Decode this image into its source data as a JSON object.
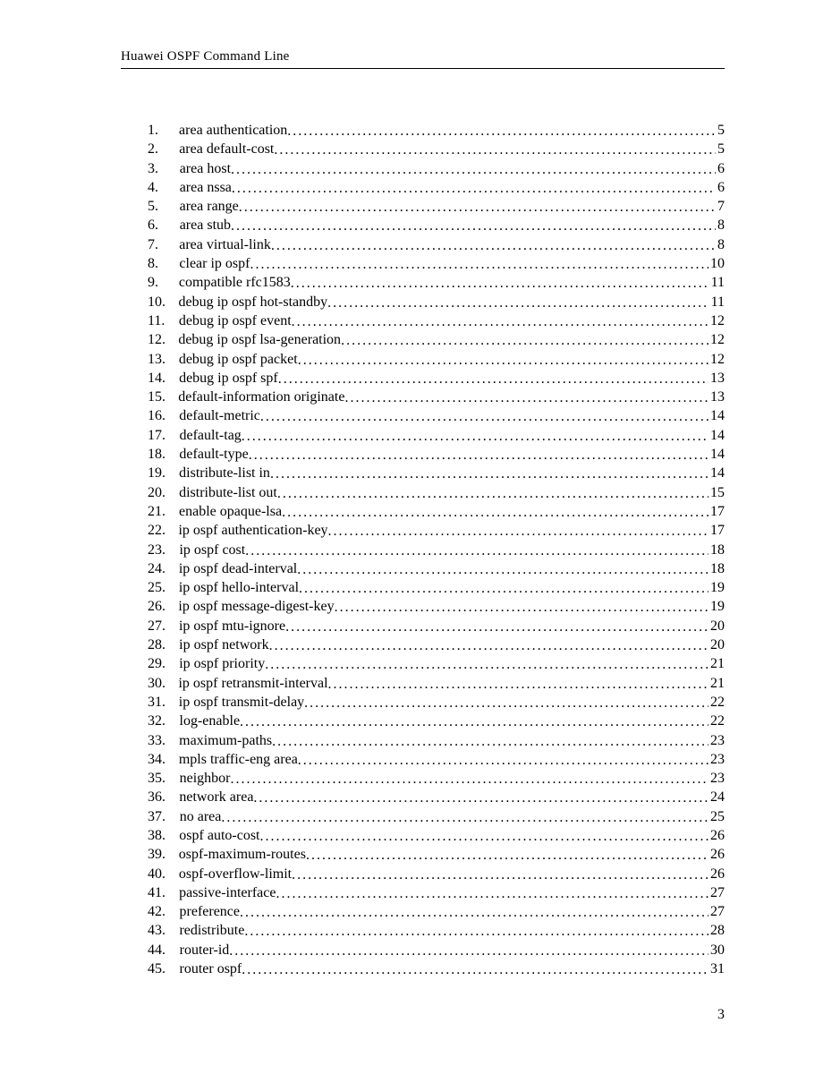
{
  "header": {
    "title": "Huawei OSPF Command Line"
  },
  "toc": {
    "entries": [
      {
        "num": "1.",
        "title": "area authentication",
        "page": "5"
      },
      {
        "num": "2.",
        "title": "area default-cost",
        "page": "5"
      },
      {
        "num": "3.",
        "title": "area host",
        "page": "6"
      },
      {
        "num": "4.",
        "title": "area nssa",
        "page": "6"
      },
      {
        "num": "5.",
        "title": "area range",
        "page": "7"
      },
      {
        "num": "6.",
        "title": "area stub",
        "page": "8"
      },
      {
        "num": "7.",
        "title": "area virtual-link",
        "page": "8"
      },
      {
        "num": "8.",
        "title": "clear ip ospf",
        "page": "10"
      },
      {
        "num": "9.",
        "title": "compatible rfc1583",
        "page": "11"
      },
      {
        "num": "10.",
        "title": "debug ip ospf hot-standby",
        "page": "11"
      },
      {
        "num": "11.",
        "title": "debug ip ospf event",
        "page": "12"
      },
      {
        "num": "12.",
        "title": "debug ip ospf lsa-generation",
        "page": "12"
      },
      {
        "num": "13.",
        "title": "debug ip ospf packet",
        "page": "12"
      },
      {
        "num": "14.",
        "title": "debug ip ospf spf",
        "page": "13"
      },
      {
        "num": "15.",
        "title": "default-information originate",
        "page": "13"
      },
      {
        "num": "16.",
        "title": "default-metric",
        "page": "14"
      },
      {
        "num": "17.",
        "title": "default-tag",
        "page": "14"
      },
      {
        "num": "18.",
        "title": "default-type",
        "page": "14"
      },
      {
        "num": "19.",
        "title": "distribute-list in",
        "page": "14"
      },
      {
        "num": "20.",
        "title": "distribute-list out",
        "page": "15"
      },
      {
        "num": "21.",
        "title": "enable opaque-lsa",
        "page": "17"
      },
      {
        "num": "22.",
        "title": "ip ospf  authentication-key",
        "page": "17"
      },
      {
        "num": "23.",
        "title": "ip ospf  cost",
        "page": "18"
      },
      {
        "num": "24.",
        "title": "ip ospf  dead-interval",
        "page": "18"
      },
      {
        "num": "25.",
        "title": "ip ospf  hello-interval",
        "page": "19"
      },
      {
        "num": "26.",
        "title": "ip ospf  message-digest-key",
        "page": "19"
      },
      {
        "num": "27.",
        "title": "ip ospf mtu-ignore",
        "page": "20"
      },
      {
        "num": "28.",
        "title": "ip ospf  network",
        "page": "20"
      },
      {
        "num": "29.",
        "title": "ip ospf  priority",
        "page": "21"
      },
      {
        "num": "30.",
        "title": "ip ospf  retransmit-interval",
        "page": "21"
      },
      {
        "num": "31.",
        "title": "ip ospf  transmit-delay",
        "page": "22"
      },
      {
        "num": "32.",
        "title": "log-enable",
        "page": "22"
      },
      {
        "num": "33.",
        "title": "maximum-paths",
        "page": "23"
      },
      {
        "num": "34.",
        "title": "mpls traffic-eng area",
        "page": "23"
      },
      {
        "num": "35.",
        "title": "neighbor",
        "page": "23"
      },
      {
        "num": "36.",
        "title": "network area",
        "page": "24"
      },
      {
        "num": "37.",
        "title": "no area",
        "page": "25"
      },
      {
        "num": "38.",
        "title": "ospf auto-cost",
        "page": "26"
      },
      {
        "num": "39.",
        "title": "ospf-maximum-routes",
        "page": "26"
      },
      {
        "num": "40.",
        "title": "ospf-overflow-limit",
        "page": "26"
      },
      {
        "num": "41.",
        "title": "passive-interface",
        "page": "27"
      },
      {
        "num": "42.",
        "title": "preference",
        "page": "27"
      },
      {
        "num": "43.",
        "title": "redistribute",
        "page": "28"
      },
      {
        "num": "44.",
        "title": "router-id",
        "page": "30"
      },
      {
        "num": "45.",
        "title": "router ospf",
        "page": "31"
      }
    ]
  },
  "footer": {
    "page_number": "3"
  }
}
